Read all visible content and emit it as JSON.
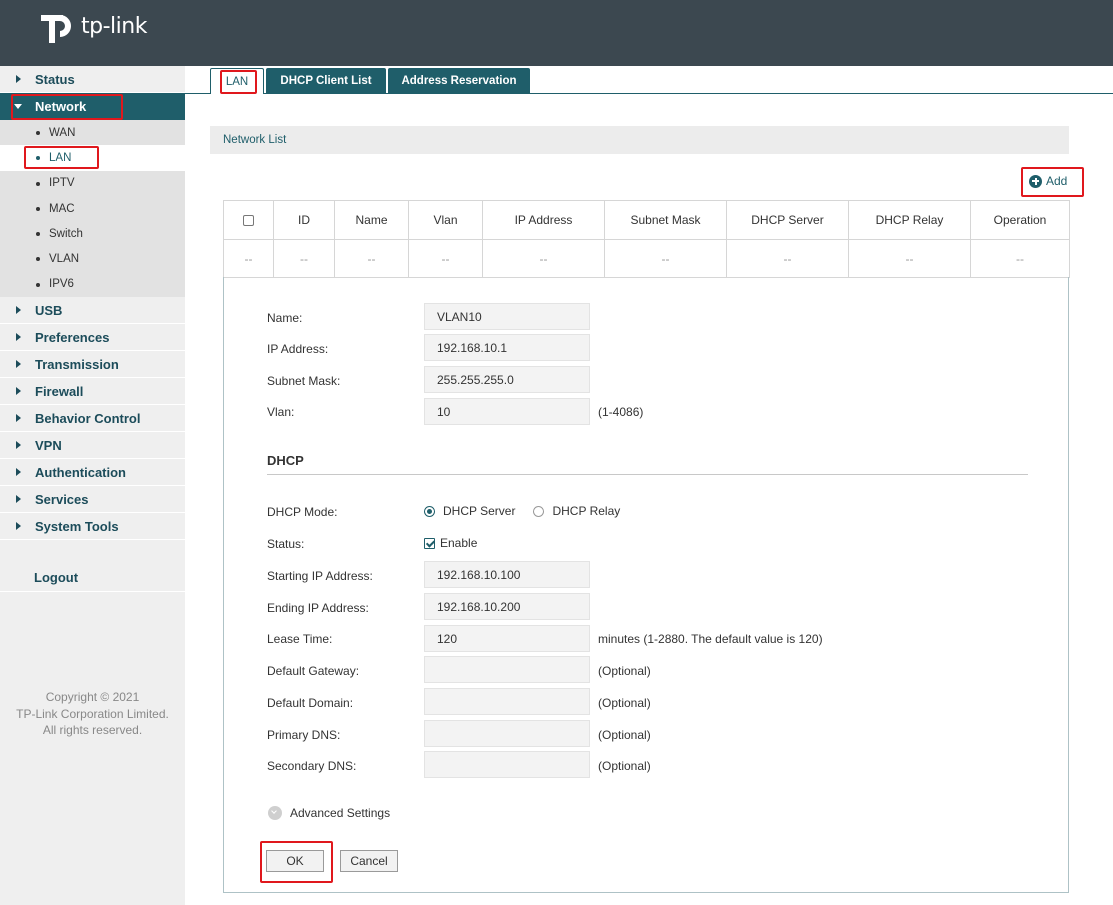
{
  "header": {
    "brand": "tp-link"
  },
  "sidebar": {
    "items": [
      {
        "label": "Status"
      },
      {
        "label": "Network"
      },
      {
        "label": "USB"
      },
      {
        "label": "Preferences"
      },
      {
        "label": "Transmission"
      },
      {
        "label": "Firewall"
      },
      {
        "label": "Behavior Control"
      },
      {
        "label": "VPN"
      },
      {
        "label": "Authentication"
      },
      {
        "label": "Services"
      },
      {
        "label": "System Tools"
      }
    ],
    "network_sub": [
      {
        "label": "WAN"
      },
      {
        "label": "LAN"
      },
      {
        "label": "IPTV"
      },
      {
        "label": "MAC"
      },
      {
        "label": "Switch"
      },
      {
        "label": "VLAN"
      },
      {
        "label": "IPV6"
      }
    ],
    "logout": "Logout",
    "copyright": [
      "Copyright © 2021",
      "TP-Link Corporation Limited.",
      "All rights reserved."
    ]
  },
  "tabs": [
    {
      "label": "LAN"
    },
    {
      "label": "DHCP Client List"
    },
    {
      "label": "Address Reservation"
    }
  ],
  "network_list": {
    "title": "Network List",
    "add_label": "Add",
    "columns": [
      "ID",
      "Name",
      "Vlan",
      "IP Address",
      "Subnet Mask",
      "DHCP Server",
      "DHCP Relay",
      "Operation"
    ],
    "empty_cell": "--"
  },
  "form": {
    "name": {
      "label": "Name:",
      "value": "VLAN10"
    },
    "ip": {
      "label": "IP Address:",
      "value": "192.168.10.1"
    },
    "mask": {
      "label": "Subnet Mask:",
      "value": "255.255.255.0"
    },
    "vlan": {
      "label": "Vlan:",
      "value": "10",
      "hint": "(1-4086)"
    },
    "dhcp_title": "DHCP",
    "dhcp_mode": {
      "label": "DHCP Mode:",
      "opt_server": "DHCP Server",
      "opt_relay": "DHCP Relay"
    },
    "status": {
      "label": "Status:",
      "enable": "Enable"
    },
    "start_ip": {
      "label": "Starting IP Address:",
      "value": "192.168.10.100"
    },
    "end_ip": {
      "label": "Ending IP Address:",
      "value": "192.168.10.200"
    },
    "lease": {
      "label": "Lease Time:",
      "value": "120",
      "hint": "minutes (1-2880. The default value is 120)"
    },
    "gateway": {
      "label": "Default Gateway:",
      "value": "",
      "hint": "(Optional)"
    },
    "domain": {
      "label": "Default Domain:",
      "value": "",
      "hint": "(Optional)"
    },
    "pdns": {
      "label": "Primary DNS:",
      "value": "",
      "hint": "(Optional)"
    },
    "sdns": {
      "label": "Secondary DNS:",
      "value": "",
      "hint": "(Optional)"
    },
    "advanced": "Advanced Settings",
    "ok": "OK",
    "cancel": "Cancel"
  }
}
